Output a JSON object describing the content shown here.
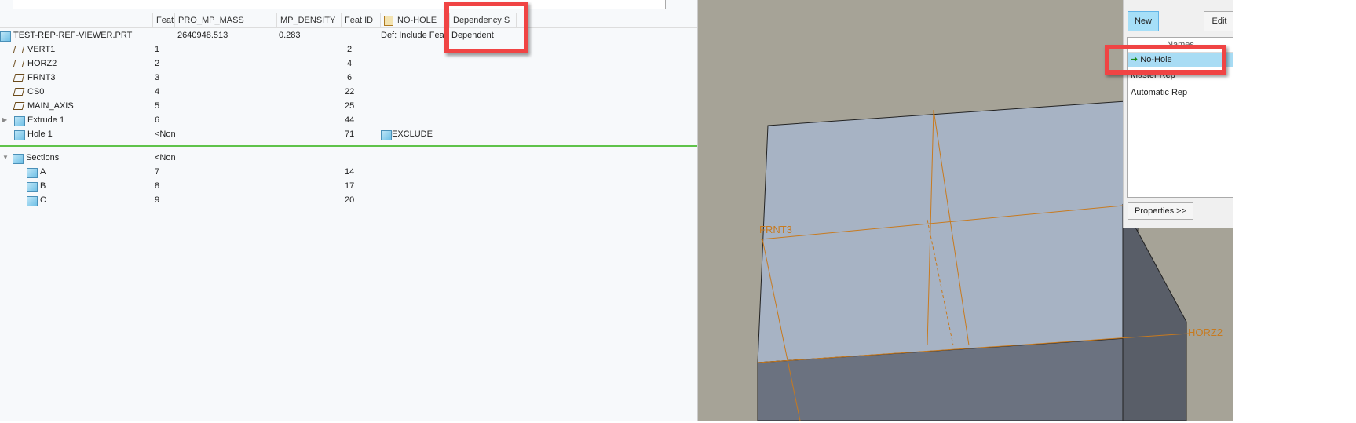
{
  "tree": {
    "columns": [
      "Feat",
      "PRO_MP_MASS",
      "MP_DENSITY",
      "Feat ID",
      "NO-HOLE",
      "Dependency S"
    ],
    "rows": [
      {
        "name": "TEST-REP-REF-VIEWER.PRT",
        "icon": "part-icon",
        "feat": "",
        "mass": "2640948.513",
        "density": "0.283",
        "id": "",
        "nohole": "Def: Include Feat",
        "dep": "Dependent"
      },
      {
        "name": "VERT1",
        "icon": "datum-plane-icon",
        "feat": "1",
        "id": "2"
      },
      {
        "name": "HORZ2",
        "icon": "datum-plane-icon",
        "feat": "2",
        "id": "4"
      },
      {
        "name": "FRNT3",
        "icon": "datum-plane-icon",
        "feat": "3",
        "id": "6"
      },
      {
        "name": "CS0",
        "icon": "coordinate-system-icon",
        "feat": "4",
        "id": "22"
      },
      {
        "name": "MAIN_AXIS",
        "icon": "axis-icon",
        "feat": "5",
        "id": "25"
      },
      {
        "name": "Extrude 1",
        "icon": "extrude-icon",
        "feat": "6",
        "id": "44"
      },
      {
        "name": "Hole 1",
        "icon": "hole-icon",
        "feat": "<Non",
        "id": "71",
        "nohole": "EXCLUDE"
      }
    ],
    "sections": {
      "name": "Sections",
      "feat": "<Non",
      "items": [
        {
          "name": "A",
          "feat": "7",
          "id": "14"
        },
        {
          "name": "B",
          "feat": "8",
          "id": "17"
        },
        {
          "name": "C",
          "feat": "9",
          "id": "20"
        }
      ]
    }
  },
  "viewport": {
    "labels": [
      "FRNT3",
      "HORZ2"
    ],
    "colors": {
      "background": "#a6a397",
      "face": "#a7b3c4",
      "datum": "#c87a1e"
    }
  },
  "dialog": {
    "new_label": "New",
    "edit_label": "Edit",
    "list_header": "Names",
    "items": [
      "No-Hole",
      "Master Rep",
      "Automatic Rep"
    ],
    "properties_label": "Properties >>"
  }
}
